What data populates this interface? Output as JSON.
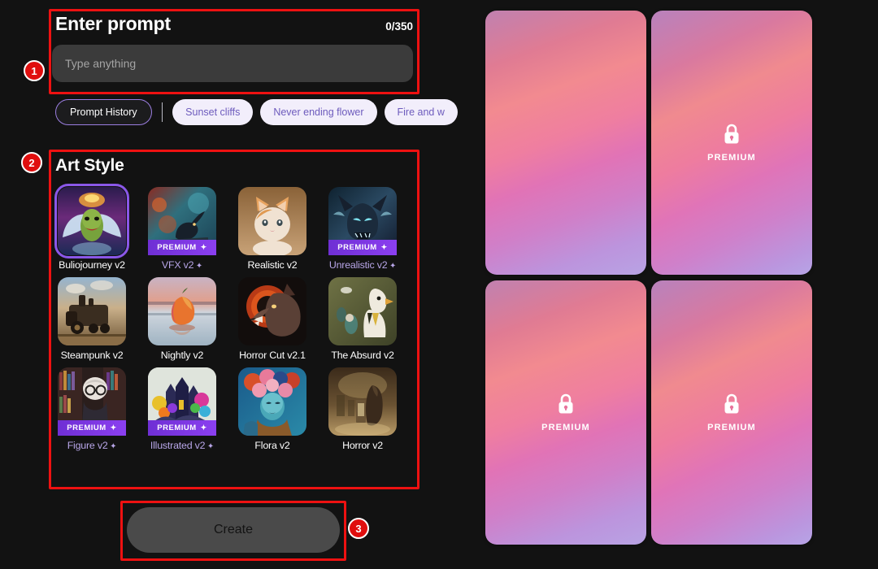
{
  "prompt": {
    "title": "Enter prompt",
    "counter": "0/350",
    "input_value": "",
    "placeholder": "Type anything"
  },
  "chips": {
    "history_label": "Prompt History",
    "suggestions": [
      {
        "label": "Sunset cliffs"
      },
      {
        "label": "Never ending flower"
      },
      {
        "label": "Fire and w"
      }
    ]
  },
  "art_style": {
    "title": "Art Style",
    "premium_badge": "PREMIUM",
    "sparkle": "✦",
    "items": [
      {
        "label": "Buliojourney v2",
        "premium": false,
        "selected": true
      },
      {
        "label": "VFX v2",
        "premium": true,
        "selected": false
      },
      {
        "label": "Realistic v2",
        "premium": false,
        "selected": false
      },
      {
        "label": "Unrealistic v2",
        "premium": true,
        "selected": false
      },
      {
        "label": "Steampunk v2",
        "premium": false,
        "selected": false
      },
      {
        "label": "Nightly v2",
        "premium": false,
        "selected": false
      },
      {
        "label": "Horror Cut v2.1",
        "premium": false,
        "selected": false
      },
      {
        "label": "The Absurd v2",
        "premium": false,
        "selected": false
      },
      {
        "label": "Figure v2",
        "premium": true,
        "selected": false
      },
      {
        "label": "Illustrated v2",
        "premium": true,
        "selected": false
      },
      {
        "label": "Flora v2",
        "premium": false,
        "selected": false
      },
      {
        "label": "Horror v2",
        "premium": false,
        "selected": false
      }
    ]
  },
  "create": {
    "label": "Create"
  },
  "annotations": {
    "markers": [
      {
        "number": "1"
      },
      {
        "number": "2"
      },
      {
        "number": "3"
      }
    ],
    "color": "#ee1111"
  },
  "preview": {
    "header_partial": "",
    "premium_label": "PREMIUM",
    "cards": [
      {
        "premium": false
      },
      {
        "premium": true
      },
      {
        "premium": true
      },
      {
        "premium": true
      }
    ]
  },
  "colors": {
    "accent_purple": "#8a57e8",
    "premium_badge": "#7a33e0",
    "chip_bg": "#f2eefb",
    "chip_text": "#6d5bbd",
    "background": "#121212",
    "annotation_red": "#ee1111"
  }
}
